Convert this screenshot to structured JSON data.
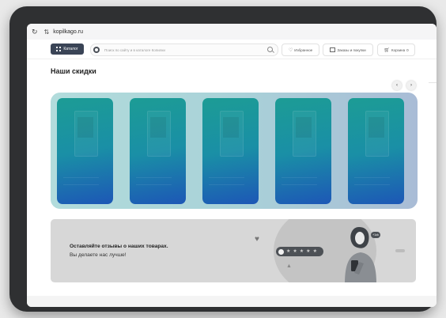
{
  "browser": {
    "reload_icon": "reload-icon",
    "site_info_icon": "site-info-icon",
    "url": "kopilkago.ru"
  },
  "header": {
    "catalog_label": "Каталог",
    "search_placeholder": "Поиск по сайту и в каталоге Копилки",
    "favorites_label": "Избранное",
    "orders_label": "Заказы и покупки",
    "cart_label": "Корзина",
    "cart_count": "0"
  },
  "main": {
    "title": "Наши скидки",
    "prev_arrow": "‹",
    "next_arrow": "›",
    "promo_count": 5
  },
  "review_banner": {
    "title": "Оставляйте отзывы о наших товарах.",
    "subtitle": "Вы делаете нас лучше!",
    "rating_stars": 5,
    "badge_text": "+1ok"
  },
  "colors": {
    "catalog_button": "#3a4456",
    "carousel_bg": "#b2dcdc",
    "promo_card_top": "#1c9c95",
    "promo_card_bottom": "#1d57b6",
    "banner_bg": "#d7d7d7",
    "device_bezel": "#2f3032"
  }
}
